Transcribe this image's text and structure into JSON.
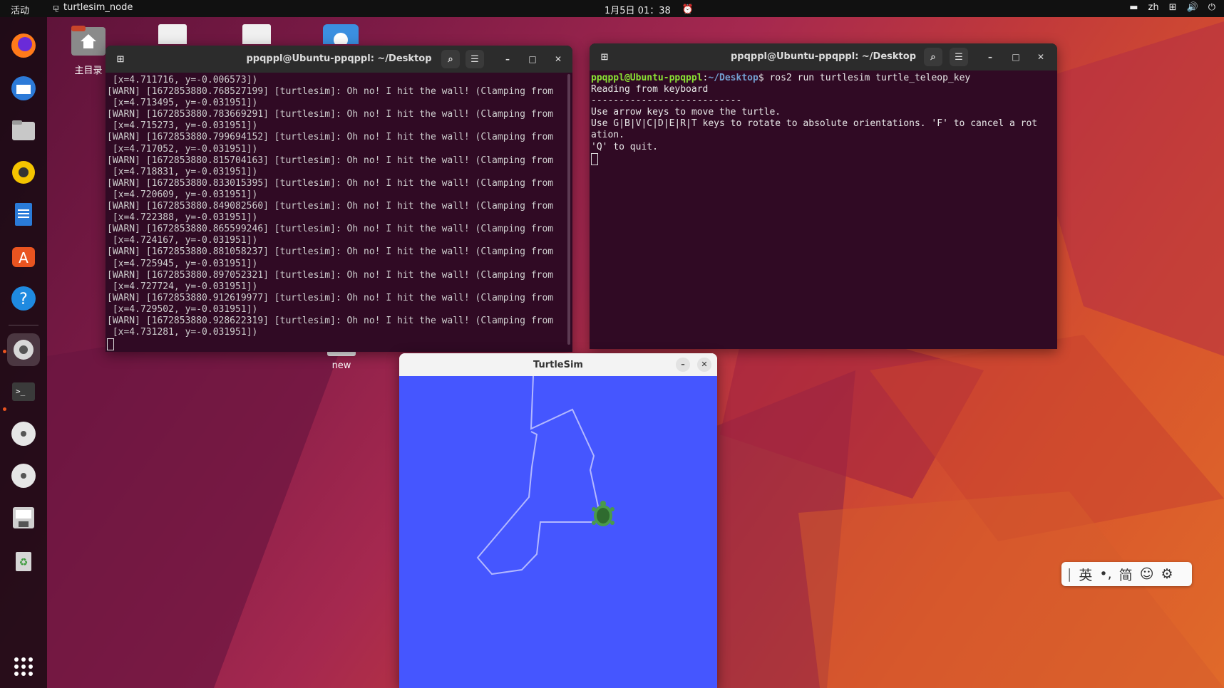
{
  "topbar": {
    "activities": "活动",
    "app_name": "turtlesim_node",
    "clock": "1月5日  01：38",
    "lang": "zh"
  },
  "desktop": {
    "home_label": "主目录",
    "new_label": "new"
  },
  "term_left": {
    "title": "ppqppl@Ubuntu-ppqppl: ~/Desktop",
    "lines": [
      " [x=4.711716, y=-0.006573])",
      "[WARN] [1672853880.768527199] [turtlesim]: Oh no! I hit the wall! (Clamping from",
      " [x=4.713495, y=-0.031951])",
      "[WARN] [1672853880.783669291] [turtlesim]: Oh no! I hit the wall! (Clamping from",
      " [x=4.715273, y=-0.031951])",
      "[WARN] [1672853880.799694152] [turtlesim]: Oh no! I hit the wall! (Clamping from",
      " [x=4.717052, y=-0.031951])",
      "[WARN] [1672853880.815704163] [turtlesim]: Oh no! I hit the wall! (Clamping from",
      " [x=4.718831, y=-0.031951])",
      "[WARN] [1672853880.833015395] [turtlesim]: Oh no! I hit the wall! (Clamping from",
      " [x=4.720609, y=-0.031951])",
      "[WARN] [1672853880.849082560] [turtlesim]: Oh no! I hit the wall! (Clamping from",
      " [x=4.722388, y=-0.031951])",
      "[WARN] [1672853880.865599246] [turtlesim]: Oh no! I hit the wall! (Clamping from",
      " [x=4.724167, y=-0.031951])",
      "[WARN] [1672853880.881058237] [turtlesim]: Oh no! I hit the wall! (Clamping from",
      " [x=4.725945, y=-0.031951])",
      "[WARN] [1672853880.897052321] [turtlesim]: Oh no! I hit the wall! (Clamping from",
      " [x=4.727724, y=-0.031951])",
      "[WARN] [1672853880.912619977] [turtlesim]: Oh no! I hit the wall! (Clamping from",
      " [x=4.729502, y=-0.031951])",
      "[WARN] [1672853880.928622319] [turtlesim]: Oh no! I hit the wall! (Clamping from",
      " [x=4.731281, y=-0.031951])"
    ]
  },
  "term_right": {
    "title": "ppqppl@Ubuntu-ppqppl: ~/Desktop",
    "prompt_user": "ppqppl@Ubuntu-ppqppl",
    "prompt_path": "~/Desktop",
    "command": "$ ros2 run turtlesim turtle_teleop_key",
    "output": [
      "Reading from keyboard",
      "---------------------------",
      "Use arrow keys to move the turtle.",
      "Use G|B|V|C|D|E|R|T keys to rotate to absolute orientations. 'F' to cancel a rot",
      "ation.",
      "'Q' to quit."
    ]
  },
  "turtlesim": {
    "title": "TurtleSim",
    "background_color": "#4556ff",
    "pen_color": "#b3b8ff"
  },
  "ime": {
    "mode": "英",
    "punct": "•,",
    "script": "简"
  },
  "dock": {
    "items": [
      "firefox-icon",
      "thunderbird-icon",
      "files-icon",
      "rhythmbox-icon",
      "writer-icon",
      "app-center-icon",
      "help-icon",
      "settings-icon",
      "terminal-icon",
      "disc-icon",
      "disc-icon-2",
      "save-icon",
      "trash-icon",
      "app-grid-icon"
    ]
  }
}
